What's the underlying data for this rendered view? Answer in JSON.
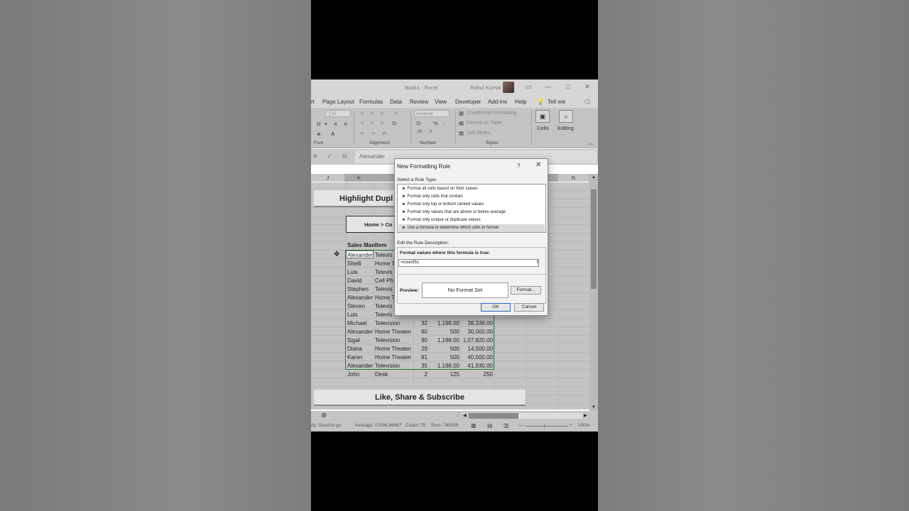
{
  "window": {
    "document_title": "Book1 - Excel",
    "user_name": "Rahul Kumar"
  },
  "menu": {
    "items": [
      "rt",
      "Page Layout",
      "Formulas",
      "Data",
      "Review",
      "View",
      "Developer",
      "Add-ins",
      "Help",
      "Tell me"
    ]
  },
  "ribbon": {
    "font_size": "11",
    "number_format": "General",
    "conditional_formatting": "Conditional Formatting",
    "format_as_table": "Format as Table",
    "cell_styles": "Cell Styles",
    "cells_label": "Cells",
    "editing_label": "Editing",
    "groups": [
      "Font",
      "Alignment",
      "Number",
      "Styles"
    ]
  },
  "formula_bar": {
    "value": "Alexander"
  },
  "columns": [
    "J",
    "K",
    "R"
  ],
  "sheet": {
    "title_banner": "Highlight Dupl",
    "path_text": "Home > Co",
    "header_salesman": "Sales Man",
    "header_item": "Item",
    "footer_banner": "Like, Share & Subscribe",
    "rows_hidden": [
      {
        "name": "Alexander",
        "item": "Televis"
      },
      {
        "name": "Shelli",
        "item": "Home T"
      },
      {
        "name": "Luis",
        "item": "Televis"
      },
      {
        "name": "David",
        "item": "Cell Ph"
      },
      {
        "name": "Stephen",
        "item": "Televis"
      },
      {
        "name": "Alexander",
        "item": "Home T"
      },
      {
        "name": "Steven",
        "item": "Televis"
      },
      {
        "name": "Luis",
        "item": "Televis"
      }
    ],
    "rows_full": [
      {
        "name": "Michael",
        "item": "Television",
        "qty": "32",
        "price": "1,198.00",
        "total": "38,336.00"
      },
      {
        "name": "Alexander",
        "item": "Home Theater",
        "qty": "60",
        "price": "500",
        "total": "30,000.00"
      },
      {
        "name": "Sigal",
        "item": "Television",
        "qty": "90",
        "price": "1,198.00",
        "total": "1,07,820.00"
      },
      {
        "name": "Diana",
        "item": "Home Theater",
        "qty": "29",
        "price": "500",
        "total": "14,500.00"
      },
      {
        "name": "Karen",
        "item": "Home Theater",
        "qty": "81",
        "price": "500",
        "total": "40,500.00"
      },
      {
        "name": "Alexander",
        "item": "Television",
        "qty": "35",
        "price": "1,198.00",
        "total": "41,930.00"
      },
      {
        "name": "John",
        "item": "Desk",
        "qty": "2",
        "price": "125",
        "total": "250"
      }
    ]
  },
  "status": {
    "accessibility": "ity: Good to go",
    "average": "Average: 17096.86667",
    "count": "Count: 75",
    "sum": "Sum: 769359",
    "zoom": "100%"
  },
  "dialog": {
    "title": "New Formatting Rule",
    "help": "?",
    "close": "✕",
    "select_rule_type_label": "Select a Rule Type:",
    "rule_types": [
      "► Format all cells based on their values",
      "► Format only cells that contain",
      "► Format only top or bottom ranked values",
      "► Format only values that are above or below average",
      "► Format only unique or duplicate values",
      "► Use a formula to determine which cells to format"
    ],
    "edit_desc_label": "Edit the Rule Description:",
    "formula_label": "Format values where this formula is true:",
    "formula_value": "=countifs(",
    "preview_label": "Preview:",
    "preview_text": "No Format Set",
    "format_button": "Format...",
    "ok_button": "OK",
    "cancel_button": "Cancel"
  }
}
